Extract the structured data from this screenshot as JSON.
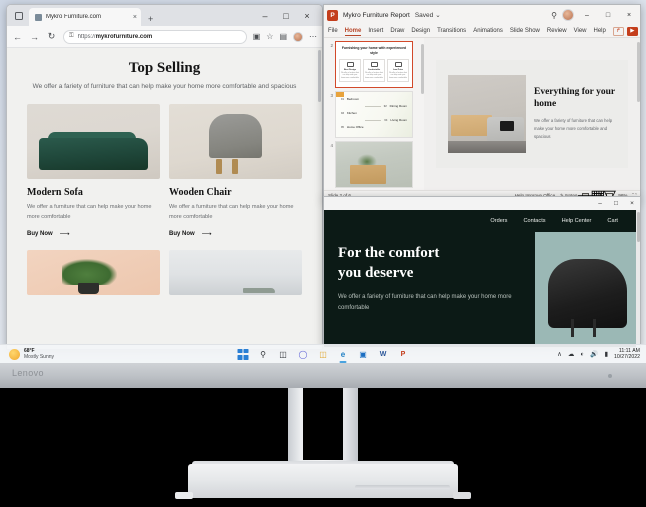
{
  "browser": {
    "tab": {
      "title": "Mykro Furniture.com",
      "close_label": "×",
      "favicon": "globe-icon"
    },
    "new_tab_label": "+",
    "window_controls": {
      "minimize": "–",
      "maximize": "□",
      "close": "×"
    },
    "nav": {
      "back": "←",
      "forward": "→",
      "reload": "↻"
    },
    "omnibox": {
      "lock": "🔒",
      "url_prefix": "https://",
      "url_domain": "mykrofurniture.com"
    },
    "toolbar_icons": [
      "collections-icon",
      "favorites-star-icon",
      "split-screen-icon",
      "profile-avatar",
      "settings-more-icon"
    ],
    "page": {
      "title": "Top Selling",
      "subtitle": "We offer a fariety of furniture that can help make your home more comfortable and spacious",
      "products": [
        {
          "name": "Modern Sofa",
          "description": "We offer a furniture that can help make your home more comfortable",
          "cta": "Buy Now",
          "cta_arrow": "⟶",
          "image": "green-modern-sofa"
        },
        {
          "name": "Wooden Chair",
          "description": "We offer a furniture that can help make your home more comfortable",
          "cta": "Buy Now",
          "cta_arrow": "⟶",
          "image": "grey-wooden-armchair"
        }
      ],
      "products_row2": [
        {
          "image": "potted-plant-on-pink-wall"
        },
        {
          "image": "minimal-white-shelf"
        }
      ]
    }
  },
  "powerpoint": {
    "app_icon_letter": "P",
    "document_name": "Mykro Furniture Report",
    "save_state": "Saved",
    "save_state_chevron": "⌵",
    "search_icon": "search-icon",
    "window_controls": {
      "minimize": "–",
      "maximize": "□",
      "close": "×"
    },
    "ribbon_tabs": [
      {
        "label": "File",
        "active": false
      },
      {
        "label": "Home",
        "active": true
      },
      {
        "label": "Insert",
        "active": false
      },
      {
        "label": "Draw",
        "active": false
      },
      {
        "label": "Design",
        "active": false
      },
      {
        "label": "Transitions",
        "active": false
      },
      {
        "label": "Animations",
        "active": false
      },
      {
        "label": "Slide Show",
        "active": false
      },
      {
        "label": "Review",
        "active": false
      },
      {
        "label": "View",
        "active": false
      },
      {
        "label": "Help",
        "active": false
      }
    ],
    "ribbon_right": [
      {
        "name": "share-button",
        "glyph": "↱"
      },
      {
        "name": "present-button",
        "glyph": "▶"
      }
    ],
    "thumbnails": [
      {
        "number": "2",
        "selected": true,
        "heading": "Furnishing your home with experienced style",
        "cards": [
          {
            "title": "Best Design",
            "text": "We offer a furniture that can help make your home more comfortable"
          },
          {
            "title": "Comfortable",
            "text": "We offer a furniture that can help make your home more comfortable"
          },
          {
            "title": "Low Price",
            "text": "We offer a furniture that can help make your home more comfortable"
          }
        ]
      },
      {
        "number": "3",
        "selected": false,
        "items": [
          {
            "num": "01",
            "label": "Bedroom"
          },
          {
            "num": "02",
            "label": "Dining Room"
          },
          {
            "num": "03",
            "label": "Kitchen"
          },
          {
            "num": "04",
            "label": "Living Room"
          },
          {
            "num": "05",
            "label": "Home Office"
          }
        ]
      },
      {
        "number": "4",
        "selected": false,
        "image": "dresser-with-plant-photo"
      }
    ],
    "slide": {
      "heading": "Everything for your home",
      "body": "We offer a fariety of furniture that can help make your home more comfortable and spacious",
      "image": "living-room-sofa-credenza"
    },
    "status": {
      "slide_counter": "Slide 2 of 6",
      "help_improve": "Help Improve Office",
      "notes": "Notes",
      "notes_icon": "notes-icon",
      "views": [
        "normal-view-icon",
        "slide-sorter-icon",
        "reading-view-icon"
      ],
      "zoom": "96%",
      "fit_slide_icon": "fit-to-window-icon"
    }
  },
  "web2": {
    "window_controls": {
      "minimize": "–",
      "maximize": "□",
      "close": "×"
    },
    "nav_links": [
      "Orders",
      "Contacts",
      "Help Center",
      "Cart"
    ],
    "hero": {
      "heading_line1": "For the comfort",
      "heading_line2": "you deserve",
      "body": "We offer a fariety of furniture that can help make your home more comfortable",
      "image": "black-designer-chair"
    },
    "accent_bg": "#0c1a16",
    "accent_panel": "#9bb8b5"
  },
  "taskbar": {
    "weather": {
      "temperature": "68°F",
      "condition": "Mostly Sunny",
      "icon": "sun-icon"
    },
    "icons": [
      {
        "name": "start-button",
        "glyph": ""
      },
      {
        "name": "search-icon",
        "glyph": "⚲"
      },
      {
        "name": "task-view-icon",
        "glyph": "◰"
      },
      {
        "name": "chat-icon",
        "glyph": "◯"
      },
      {
        "name": "file-explorer-icon",
        "glyph": "▭"
      },
      {
        "name": "edge-browser-icon",
        "glyph": "e",
        "active": true
      },
      {
        "name": "microsoft-store-icon",
        "glyph": "▣"
      },
      {
        "name": "word-icon",
        "glyph": "W"
      },
      {
        "name": "powerpoint-icon",
        "glyph": "P"
      }
    ],
    "tray": {
      "chevron": "∧",
      "onedrive_icon": "cloud-icon",
      "network_icon": "wifi-icon",
      "volume_icon": "speaker-icon",
      "battery_icon": "battery-icon",
      "time": "11:11 AM",
      "date": "10/27/2022"
    }
  },
  "monitor": {
    "brand": "Lenovo"
  }
}
